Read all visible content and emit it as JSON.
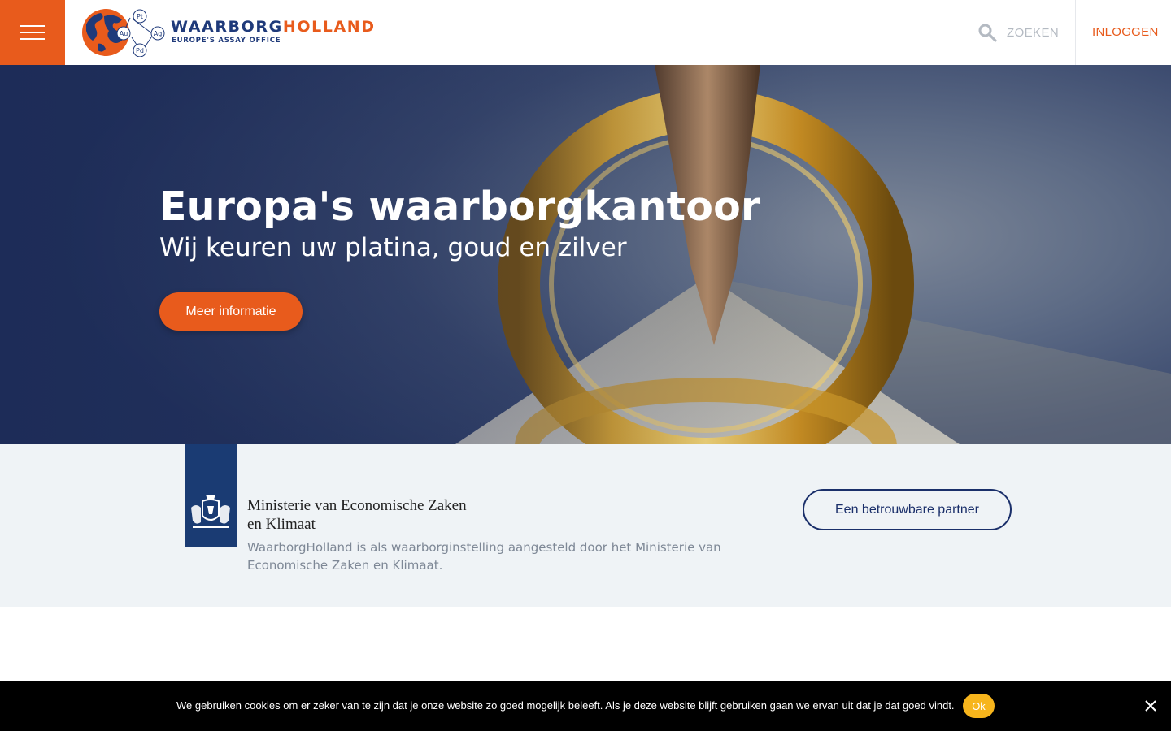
{
  "header": {
    "menu_icon": "hamburger-icon",
    "logo": {
      "word_part1": "WAARBORG",
      "word_part2": "HOLLAND",
      "tagline": "EUROPE'S ASSAY OFFICE",
      "elements": [
        "Pt",
        "Au",
        "Ag",
        "Pd"
      ]
    },
    "search_icon": "search-icon",
    "search_label": "ZOEKEN",
    "login_label": "INLOGGEN"
  },
  "hero": {
    "title": "Europa's waarborgkantoor",
    "subtitle": "Wij keuren uw platina, goud en zilver",
    "button_label": "Meer informatie"
  },
  "ministry": {
    "name_line1": "Ministerie van Economische Zaken",
    "name_line2": "en Klimaat",
    "description": "WaarborgHolland is als waarborginstelling aangesteld door het Ministerie van Economische Zaken en Klimaat.",
    "partner_button": "Een betrouwbare partner"
  },
  "cookie": {
    "text": "We gebruiken cookies om er zeker van te zijn dat je onze website zo goed mogelijk beleeft. Als je deze website blijft gebruiken gaan we ervan uit dat je dat goed vindt.",
    "ok_label": "Ok",
    "close_icon": "close-icon"
  },
  "colors": {
    "brand_orange": "#e85b1c",
    "brand_navy": "#1a2f6a",
    "band_background": "#eff3f6",
    "cookie_ok": "#f7b51c"
  }
}
